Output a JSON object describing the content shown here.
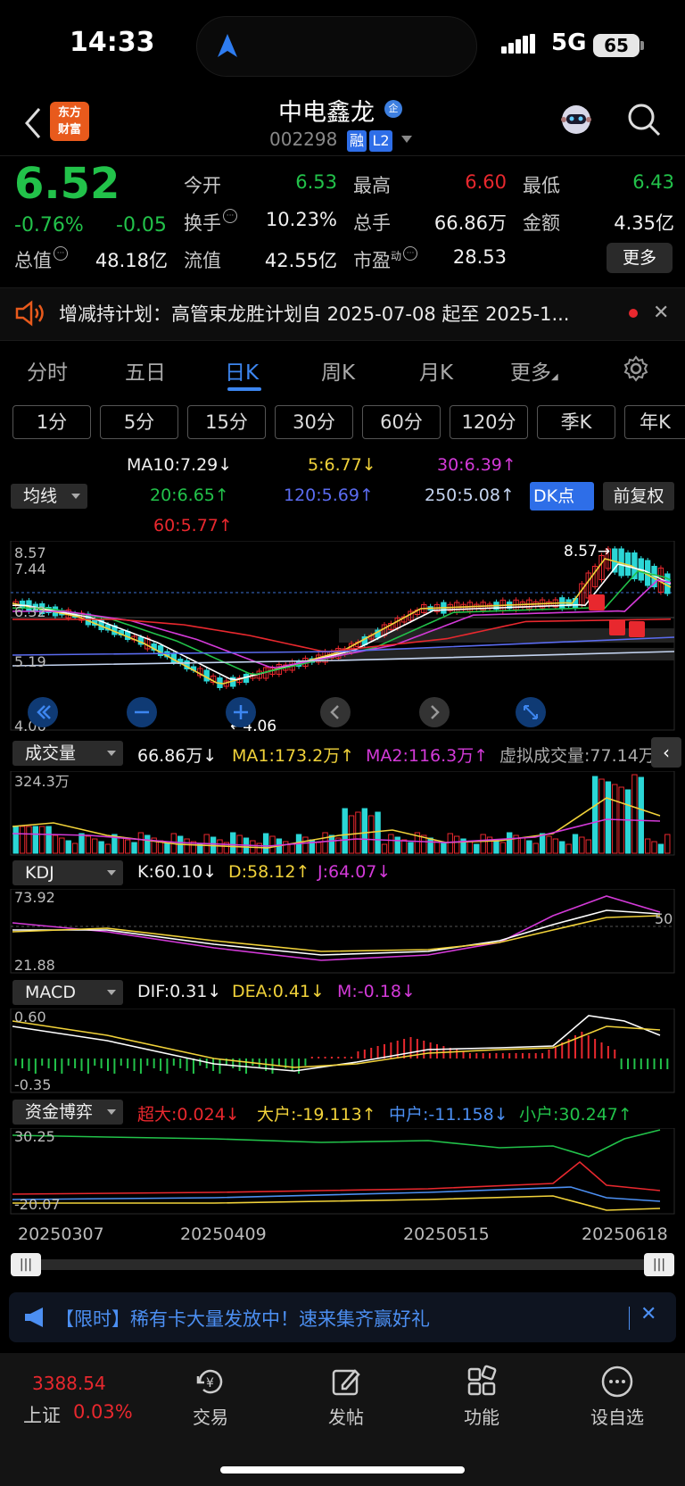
{
  "status": {
    "time": "14:33",
    "network": "5G",
    "battery": "65"
  },
  "header": {
    "logo_line1": "东方",
    "logo_line2": "财富",
    "name": "中电鑫龙",
    "badge": "企",
    "code": "002298",
    "tag1": "融",
    "tag2": "L2"
  },
  "quote": {
    "price": "6.52",
    "change_pct": "-0.76%",
    "change": "-0.05",
    "open_label": "今开",
    "open": "6.53",
    "high_label": "最高",
    "high": "6.60",
    "low_label": "最低",
    "low": "6.43",
    "turnover_label": "换手",
    "turnover": "10.23%",
    "volume_label": "总手",
    "volume": "66.86万",
    "amount_label": "金额",
    "amount": "4.35亿",
    "mktcap_label": "总值",
    "mktcap": "48.18亿",
    "float_label": "流值",
    "float": "42.55亿",
    "pe_label": "市盈",
    "pe_sup": "动",
    "pe": "28.53",
    "more": "更多"
  },
  "notice": {
    "text": "增减持计划：高管束龙胜计划自 2025-07-08 起至 2025-1..."
  },
  "tabs": [
    "分时",
    "五日",
    "日K",
    "周K",
    "月K",
    "更多"
  ],
  "periods": [
    "1分",
    "5分",
    "15分",
    "30分",
    "60分",
    "120分",
    "季K",
    "年K"
  ],
  "ma": {
    "ma10": "MA10:7.29",
    "ma5": "5:6.77",
    "ma30": "30:6.39",
    "ma20": "20:6.65",
    "ma120": "120:5.69",
    "ma250": "250:5.08",
    "ma60": "60:5.77",
    "selector": "均线",
    "dk": "DK点",
    "fq": "前复权"
  },
  "kline": {
    "y_labels": [
      "8.57",
      "7.44",
      "6.32",
      "5.19",
      "4.06"
    ],
    "high_mark": "8.57",
    "low_mark": "4.06"
  },
  "volume": {
    "selector": "成交量",
    "vol": "66.86万",
    "ma1": "MA1:173.2万",
    "ma2": "MA2:116.3万",
    "virtual": "虚拟成交量:77.14万",
    "y_top": "324.3万"
  },
  "kdj": {
    "selector": "KDJ",
    "k": "K:60.10",
    "d": "D:58.12",
    "j": "J:64.07",
    "y_top": "73.92",
    "y_bottom": "21.88",
    "mid": "50"
  },
  "macd": {
    "selector": "MACD",
    "dif": "DIF:0.31",
    "dea": "DEA:0.41",
    "m": "M:-0.18",
    "y_top": "0.60",
    "y_bottom": "-0.35"
  },
  "funds": {
    "selector": "资金博弈",
    "super": "超大:0.024",
    "large": "大户:-19.113",
    "mid": "中户:-11.158",
    "small": "小户:30.247",
    "y_top": "30.25",
    "y_bottom": "-20.07"
  },
  "dates": [
    "20250307",
    "20250409",
    "20250515",
    "20250618"
  ],
  "promo": {
    "text": "【限时】稀有卡大量发放中！速来集齐赢好礼"
  },
  "nav": {
    "index_value": "3388.54",
    "index_name": "上证",
    "index_pct": "0.03%",
    "trade": "交易",
    "post": "发帖",
    "func": "功能",
    "watch": "设自选"
  },
  "colors": {
    "up": "#e8282e",
    "down": "#22c24a",
    "accent": "#2e6ee8"
  }
}
